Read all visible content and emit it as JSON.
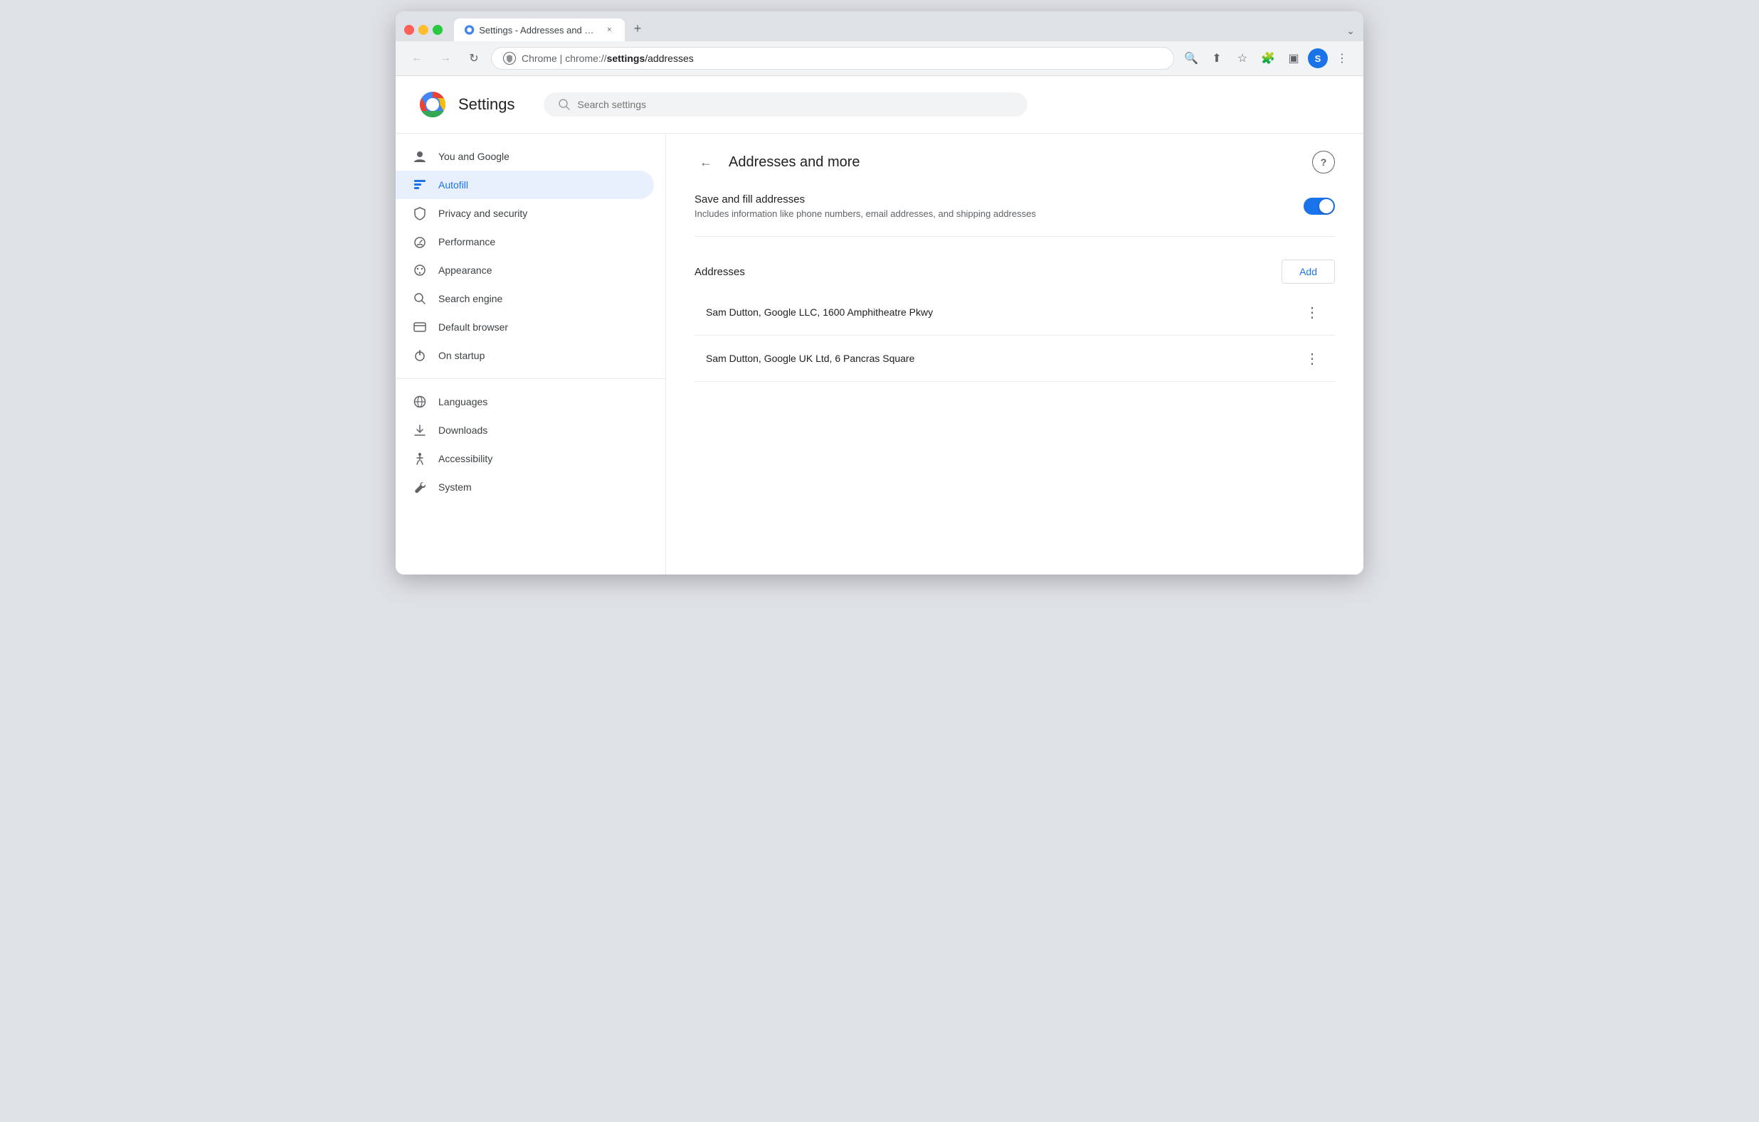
{
  "browser": {
    "tab_title": "Settings - Addresses and more",
    "tab_close_label": "×",
    "new_tab_label": "+",
    "tab_chevron": "⌄",
    "nav": {
      "back_label": "←",
      "forward_label": "→",
      "refresh_label": "↻",
      "address_scheme": "chrome://",
      "address_host": "settings",
      "address_path": "/addresses",
      "address_display": "Chrome | chrome://settings/addresses"
    },
    "toolbar": {
      "search_icon_label": "🔍",
      "share_icon_label": "⬆",
      "bookmark_icon_label": "☆",
      "extensions_icon_label": "🧩",
      "sidebar_icon_label": "▣",
      "menu_icon_label": "⋮",
      "avatar_label": "S"
    }
  },
  "settings": {
    "title": "Settings",
    "search_placeholder": "Search settings",
    "sidebar": {
      "items": [
        {
          "id": "you-and-google",
          "label": "You and Google",
          "icon": "person"
        },
        {
          "id": "autofill",
          "label": "Autofill",
          "icon": "autofill",
          "active": true
        },
        {
          "id": "privacy-security",
          "label": "Privacy and security",
          "icon": "shield"
        },
        {
          "id": "performance",
          "label": "Performance",
          "icon": "gauge"
        },
        {
          "id": "appearance",
          "label": "Appearance",
          "icon": "palette"
        },
        {
          "id": "search-engine",
          "label": "Search engine",
          "icon": "search"
        },
        {
          "id": "default-browser",
          "label": "Default browser",
          "icon": "browser"
        },
        {
          "id": "on-startup",
          "label": "On startup",
          "icon": "power"
        }
      ],
      "items2": [
        {
          "id": "languages",
          "label": "Languages",
          "icon": "globe"
        },
        {
          "id": "downloads",
          "label": "Downloads",
          "icon": "download"
        },
        {
          "id": "accessibility",
          "label": "Accessibility",
          "icon": "accessibility"
        },
        {
          "id": "system",
          "label": "System",
          "icon": "wrench"
        }
      ]
    },
    "main": {
      "back_label": "←",
      "page_title": "Addresses and more",
      "help_label": "?",
      "toggle": {
        "label": "Save and fill addresses",
        "description": "Includes information like phone numbers, email addresses, and shipping addresses",
        "enabled": true
      },
      "addresses": {
        "section_label": "Addresses",
        "add_button_label": "Add",
        "items": [
          {
            "text": "Sam Dutton, Google LLC, 1600 Amphitheatre Pkwy",
            "menu_icon": "⋮"
          },
          {
            "text": "Sam Dutton, Google UK Ltd, 6 Pancras Square",
            "menu_icon": "⋮"
          }
        ]
      }
    }
  }
}
